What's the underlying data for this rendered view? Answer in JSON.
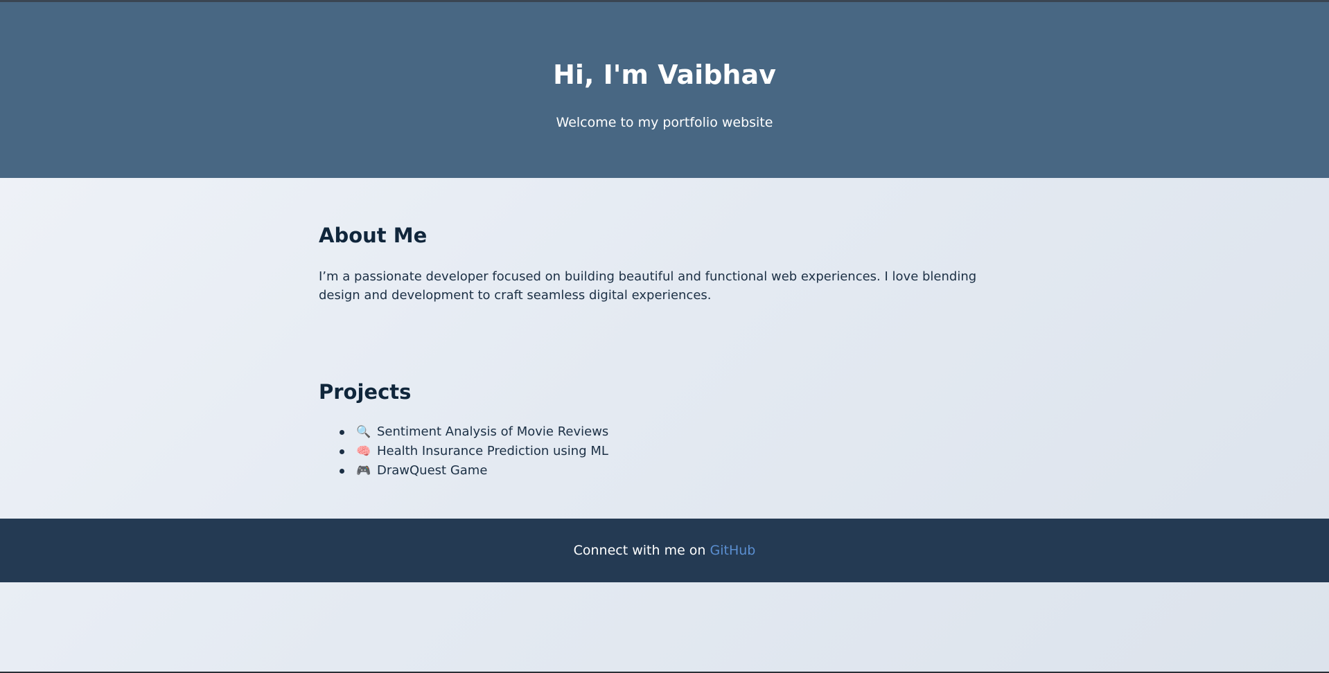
{
  "header": {
    "title": "Hi, I'm Vaibhav",
    "subtitle": "Welcome to my portfolio website"
  },
  "about": {
    "heading": "About Me",
    "text": "I’m a passionate developer focused on building beautiful and functional web experiences. I love blending design and development to craft seamless digital experiences."
  },
  "projects": {
    "heading": "Projects",
    "items": [
      {
        "icon": "🔍",
        "icon_name": "magnifier-icon",
        "label": "Sentiment Analysis of Movie Reviews"
      },
      {
        "icon": "🧠",
        "icon_name": "brain-icon",
        "label": "Health Insurance Prediction using ML"
      },
      {
        "icon": "🎮",
        "icon_name": "gamepad-icon",
        "label": "DrawQuest Game"
      }
    ]
  },
  "footer": {
    "text": "Connect with me on ",
    "link_label": "GitHub"
  },
  "colors": {
    "header_bg": "#486783",
    "footer_bg": "#243a53",
    "link": "#5b8fd1"
  }
}
